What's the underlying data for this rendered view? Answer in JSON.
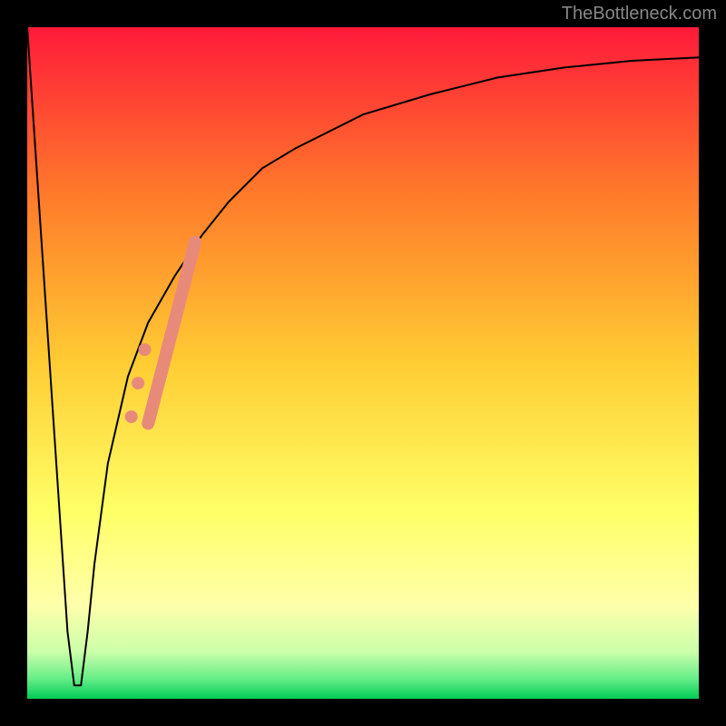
{
  "watermark": "TheBottleneck.com",
  "chart_data": {
    "type": "line",
    "title": "",
    "xlabel": "",
    "ylabel": "",
    "xlim": [
      0,
      100
    ],
    "ylim": [
      0,
      100
    ],
    "background_gradient": {
      "top_color": "#ff1a3a",
      "mid_color": "#ffcc00",
      "bottom_color": "#00dd66",
      "stops": [
        {
          "offset": 0.0,
          "color": "#ff1a3a"
        },
        {
          "offset": 0.25,
          "color": "#ff7a2a"
        },
        {
          "offset": 0.5,
          "color": "#ffcc33"
        },
        {
          "offset": 0.72,
          "color": "#ffff66"
        },
        {
          "offset": 0.86,
          "color": "#ffffaa"
        },
        {
          "offset": 0.93,
          "color": "#ccffaa"
        },
        {
          "offset": 0.97,
          "color": "#66ee88"
        },
        {
          "offset": 1.0,
          "color": "#00cc55"
        }
      ]
    },
    "series": [
      {
        "name": "bottleneck-curve",
        "color": "#000000",
        "stroke_width": 2,
        "x": [
          0,
          2,
          4,
          6,
          7,
          8,
          9,
          10,
          12,
          15,
          18,
          22,
          26,
          30,
          35,
          40,
          50,
          60,
          70,
          80,
          90,
          100
        ],
        "y": [
          100,
          70,
          40,
          10,
          2,
          2,
          10,
          20,
          35,
          48,
          56,
          63,
          69,
          74,
          79,
          82,
          87,
          90,
          92.5,
          94,
          95,
          95.5
        ]
      }
    ],
    "marker_band": {
      "name": "highlight-band",
      "color": "#e88a7a",
      "x_range": [
        18,
        25
      ],
      "y_range": [
        41,
        68
      ],
      "stroke_width": 14
    },
    "marker_points": {
      "name": "highlight-dots",
      "color": "#e88a7a",
      "radius": 7,
      "points": [
        {
          "x": 17.5,
          "y": 52
        },
        {
          "x": 16.5,
          "y": 47
        },
        {
          "x": 15.5,
          "y": 42
        }
      ]
    }
  }
}
